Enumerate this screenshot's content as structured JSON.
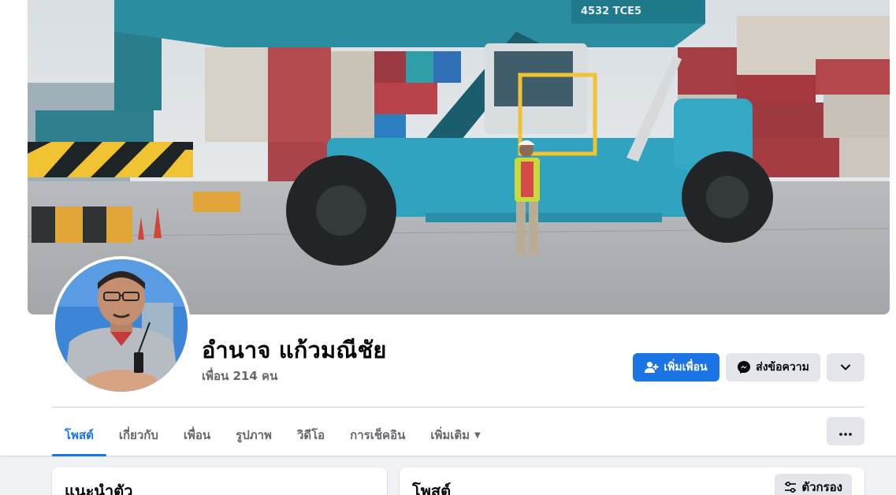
{
  "profile": {
    "name": "อำนาจ แก้วมณีชัย",
    "friends_count": "เพื่อน 214 คน"
  },
  "actions": {
    "add_friend_label": "เพิ่มเพื่อน",
    "message_label": "ส่งข้อความ",
    "add_friend_icon": "person-add-icon",
    "message_icon": "messenger-icon",
    "more_icon": "chevron-down-icon"
  },
  "tabs": [
    {
      "label": "โพสต์",
      "active": true
    },
    {
      "label": "เกี่ยวกับ",
      "active": false
    },
    {
      "label": "เพื่อน",
      "active": false
    },
    {
      "label": "รูปภาพ",
      "active": false
    },
    {
      "label": "วิดีโอ",
      "active": false
    },
    {
      "label": "การเช็คอิน",
      "active": false
    },
    {
      "label": "เพิ่มเติม",
      "active": false
    }
  ],
  "cover": {
    "vehicle_text": "4532 TCE5"
  },
  "cards": {
    "intro_title": "แนะนำตัว",
    "posts_title": "โพสต์",
    "filter_label": "ตัวกรอง"
  },
  "colors": {
    "accent": "#1b74e4",
    "secondary_button": "#e4e6eb",
    "muted_text": "#65676b"
  }
}
